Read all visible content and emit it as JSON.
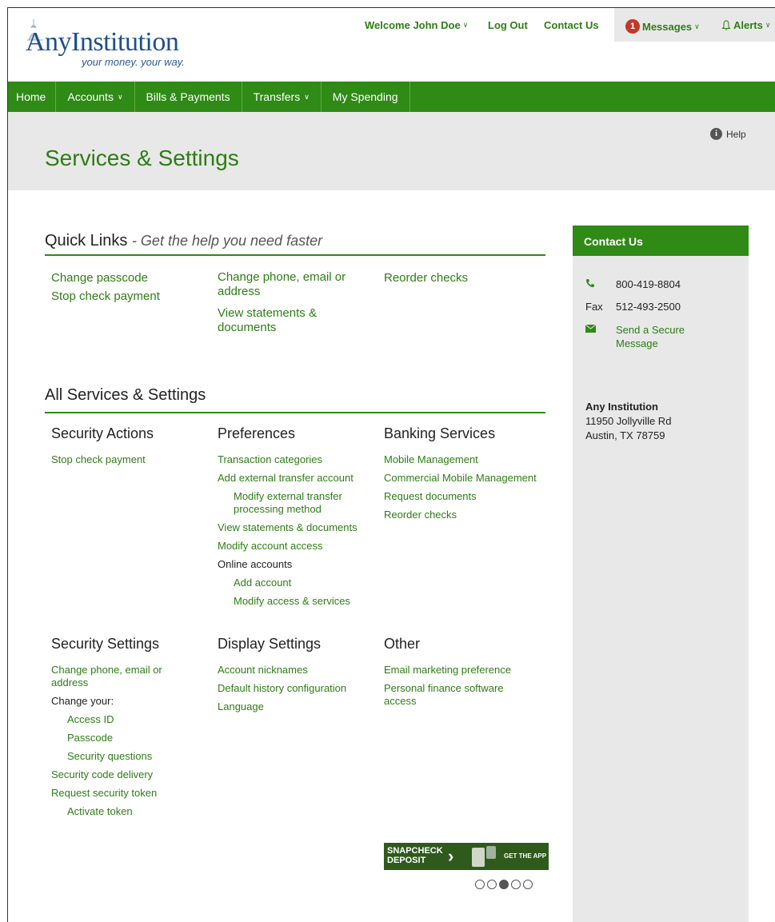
{
  "brand": {
    "name": "AnyInstitution",
    "tagline": "your money. your way."
  },
  "topbar": {
    "welcome": "Welcome John Doe",
    "logout": "Log Out",
    "contact": "Contact Us",
    "messages_count": "1",
    "messages": "Messages",
    "alerts": "Alerts"
  },
  "navbar": {
    "items": [
      {
        "label": "Home"
      },
      {
        "label": "Accounts"
      },
      {
        "label": "Bills & Payments"
      },
      {
        "label": "Transfers"
      },
      {
        "label": "My Spending"
      }
    ]
  },
  "page": {
    "title": "Services & Settings",
    "help": "Help"
  },
  "quick_links": {
    "title": "Quick Links",
    "subtitle": "- Get the help you need faster",
    "col1": [
      "Change passcode",
      "Stop check payment"
    ],
    "col2": [
      "Change phone, email or address",
      "View statements & documents"
    ],
    "col3": [
      "Reorder checks"
    ]
  },
  "all_services": {
    "title": "All Services & Settings",
    "security_actions": {
      "heading": "Security Actions",
      "items": [
        "Stop check payment"
      ]
    },
    "preferences": {
      "heading": "Preferences",
      "transaction_categories": "Transaction categories",
      "add_external": "Add external transfer account",
      "modify_external": "Modify external transfer processing method",
      "view_statements": "View statements & documents",
      "modify_access": "Modify account access",
      "online_accounts": "Online accounts",
      "add_account": "Add account",
      "modify_access_services": "Modify access & services"
    },
    "banking_services": {
      "heading": "Banking Services",
      "items": [
        "Mobile Management",
        "Commercial Mobile Management",
        "Request documents",
        "Reorder checks"
      ]
    },
    "security_settings": {
      "heading": "Security Settings",
      "change_contact": "Change phone, email or address",
      "change_your": "Change your:",
      "access_id": "Access ID",
      "passcode": "Passcode",
      "security_questions": "Security questions",
      "code_delivery": "Security code delivery",
      "request_token": "Request security token",
      "activate_token": "Activate token"
    },
    "display_settings": {
      "heading": "Display Settings",
      "items": [
        "Account nicknames",
        "Default history configuration",
        "Language"
      ]
    },
    "other": {
      "heading": "Other",
      "items": [
        "Email marketing preference",
        "Personal finance software access"
      ]
    }
  },
  "contact_panel": {
    "title": "Contact Us",
    "phone": "800-419-8804",
    "fax_label": "Fax",
    "fax": "512-493-2500",
    "secure_message": "Send a Secure Message",
    "institution": "Any Institution",
    "address1": "11950 Jollyville Rd",
    "address2": "Austin, TX  78759"
  },
  "ad": {
    "line1": "SNAPCHECK",
    "line2": "DEPOSIT",
    "cta": "GET THE APP",
    "slide_active": 3,
    "slide_count": 5
  },
  "colors": {
    "brand_green": "#2f8a16",
    "link_green": "#2e7d16",
    "panel_gray": "#e8e8e8",
    "badge_red": "#c0392b"
  }
}
